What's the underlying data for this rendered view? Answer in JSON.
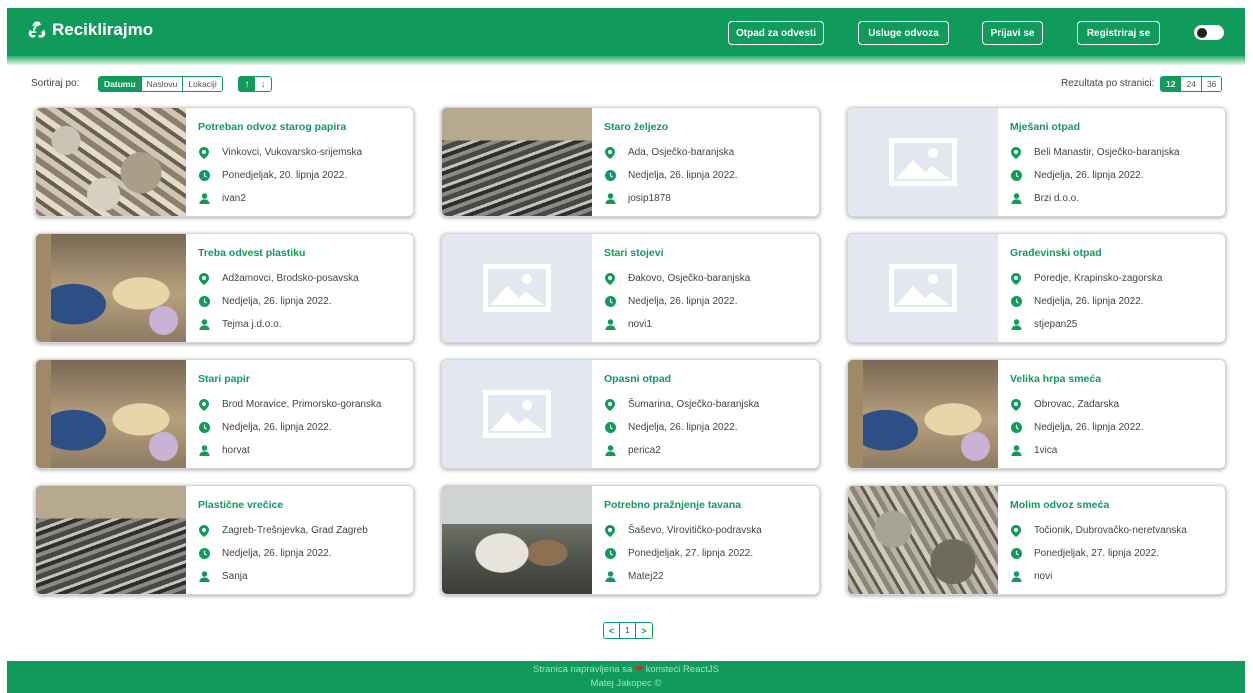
{
  "header": {
    "brand": "Reciklirajmo",
    "nav": [
      "Otpad za odvesti",
      "Usluge odvoza",
      "Prijavi se",
      "Registriraj se"
    ]
  },
  "sort": {
    "label": "Sortiraj po:",
    "options": [
      "Datumu",
      "Naslovu",
      "Lokaciji"
    ],
    "up": "↑",
    "down": "↓"
  },
  "per_page": {
    "label": "Rezultata po stranici:",
    "options": [
      "12",
      "24",
      "36"
    ]
  },
  "cards": [
    {
      "title": "Potreban odvoz starog papira",
      "location": "Vinkovci, Vukovarsko-srijemska",
      "date": "Ponedjeljak, 20. lipnja 2022.",
      "user": "ivan2"
    },
    {
      "title": "Staro željezo",
      "location": "Ada, Osječko-baranjska",
      "date": "Nedjelja, 26. lipnja 2022.",
      "user": "josip1878"
    },
    {
      "title": "Mješani otpad",
      "location": "Beli Manastir, Osječko-baranjska",
      "date": "Nedjelja, 26. lipnja 2022.",
      "user": "Brzi d.o.o."
    },
    {
      "title": "Treba odvest plastiku",
      "location": "Adžamovci, Brodsko-posavska",
      "date": "Nedjelja, 26. lipnja 2022.",
      "user": "Tejma j.d.o.o."
    },
    {
      "title": "Stari stojevi",
      "location": "Đakovo, Osječko-baranjska",
      "date": "Nedjelja, 26. lipnja 2022.",
      "user": "novi1"
    },
    {
      "title": "Građevinski otpad",
      "location": "Poredje, Krapinsko-zagorska",
      "date": "Nedjelja, 26. lipnja 2022.",
      "user": "stjepan25"
    },
    {
      "title": "Stari papir",
      "location": "Brod Moravice, Primorsko-goranska",
      "date": "Nedjelja, 26. lipnja 2022.",
      "user": "horvat"
    },
    {
      "title": "Opasni otpad",
      "location": "Šumarina, Osječko-baranjska",
      "date": "Nedjelja, 26. lipnja 2022.",
      "user": "perica2"
    },
    {
      "title": "Velika hrpa smeća",
      "location": "Obrovac, Zadarska",
      "date": "Nedjelja, 26. lipnja 2022.",
      "user": "1vica"
    },
    {
      "title": "Plastične vrečice",
      "location": "Zagreb-Trešnjevka, Grad Zagreb",
      "date": "Nedjelja, 26. lipnja 2022.",
      "user": "Sanja"
    },
    {
      "title": "Potrebno pražnjenje tavana",
      "location": "Šaševo, Virovitičko-podravska",
      "date": "Ponedjeljak, 27. lipnja 2022.",
      "user": "Matej22"
    },
    {
      "title": "Molim odvoz smeća",
      "location": "Točionik, Dubrovačko-neretvanska",
      "date": "Ponedjeljak, 27. lipnja 2022.",
      "user": "novi"
    }
  ],
  "pagination": {
    "prev": "<",
    "current": "1",
    "next": ">"
  },
  "footer": {
    "line1_before": "Stranica napravljena sa",
    "line1_after": "koristeći ReactJS",
    "line2": "Matej Jakopec ©"
  },
  "colors": {
    "primary": "#109a5b",
    "placeholder": "#e3e8f0"
  }
}
